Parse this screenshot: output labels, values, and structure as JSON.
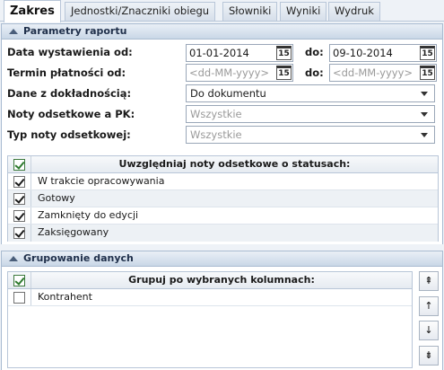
{
  "tabs": [
    "Zakres",
    "Jednostki/Znaczniki obiegu",
    "Słowniki",
    "Wyniki",
    "Wydruk"
  ],
  "sections": {
    "params_title": "Parametry raportu",
    "grouping_title": "Grupowanie danych"
  },
  "form": {
    "issue_date_label": "Data wystawienia od:",
    "issue_date_from": "01-01-2014",
    "issue_date_to_label": "do:",
    "issue_date_to": "09-10-2014",
    "due_date_label": "Termin płatności od:",
    "due_date_from_placeholder": "<dd-MM-yyyy>",
    "due_date_to_label": "do:",
    "due_date_to_placeholder": "<dd-MM-yyyy>",
    "precision_label": "Dane z dokładnością:",
    "precision_value": "Do dokumentu",
    "notes_pk_label": "Noty odsetkowe a PK:",
    "notes_pk_value": "Wszystkie",
    "note_type_label": "Typ noty odsetkowej:",
    "note_type_value": "Wszystkie",
    "calendar_icon_text": "15"
  },
  "status_grid": {
    "header": "Uwzględniaj noty odsetkowe o statusach:",
    "rows": [
      {
        "label": "W trakcie opracowywania",
        "checked": true
      },
      {
        "label": "Gotowy",
        "checked": true
      },
      {
        "label": "Zamknięty do edycji",
        "checked": true
      },
      {
        "label": "Zaksięgowany",
        "checked": true
      }
    ]
  },
  "group_grid": {
    "header": "Grupuj po wybranych kolumnach:",
    "rows": [
      {
        "label": "Kontrahent",
        "checked": false
      }
    ]
  },
  "side_buttons": [
    "move-top",
    "move-up",
    "move-down",
    "move-bottom"
  ]
}
